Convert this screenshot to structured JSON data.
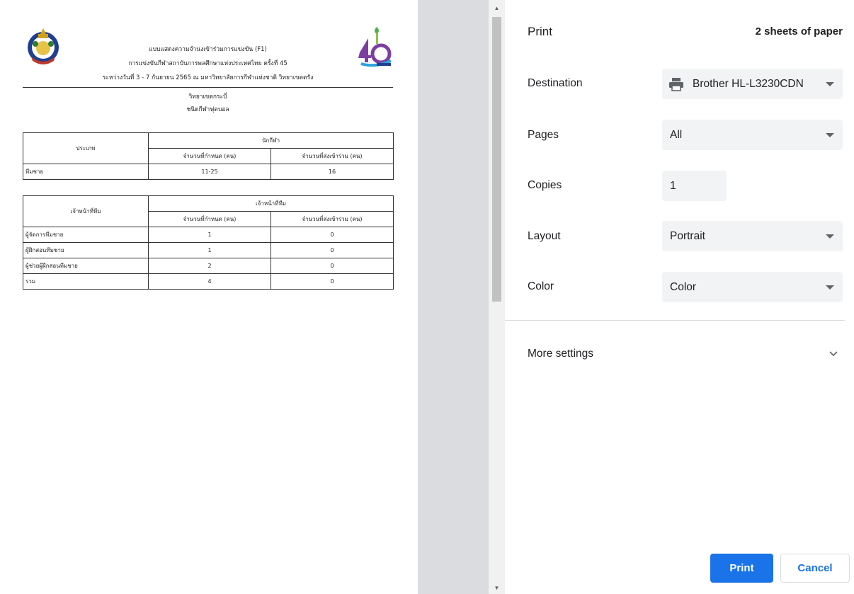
{
  "preview": {
    "header": {
      "line1": "แบบแสดงความจำนงเข้าร่วมการแข่งขัน (F1)",
      "line2": "การแข่งขันกีฬาสถาบันการพลศึกษาแห่งประเทศไทย ครั้งที่ 45",
      "line3": "ระหว่างวันที่ 3 - 7 กันยายน 2565 ณ มหาวิทยาลัยการกีฬาแห่งชาติ วิทยาเขตตรัง"
    },
    "campus": "วิทยาเขตกระบี่",
    "sport": "ชนิดกีฬาฟุตบอล",
    "table1": {
      "col_type": "ประเภท",
      "group": "นักกีฬา",
      "col_required": "จำนวนที่กำหนด (คน)",
      "col_submitted": "จำนวนที่ส่งเข้าร่วม (คน)",
      "rows": [
        {
          "name": "ทีมชาย",
          "required": "11-25",
          "submitted": "16"
        }
      ]
    },
    "table2": {
      "col_type": "เจ้าหน้าที่ทีม",
      "group": "เจ้าหน้าที่ทีม",
      "col_required": "จำนวนที่กำหนด (คน)",
      "col_submitted": "จำนวนที่ส่งเข้าร่วม (คน)",
      "rows": [
        {
          "name": "ผู้จัดการทีมชาย",
          "required": "1",
          "submitted": "0"
        },
        {
          "name": "ผู้ฝึกสอนทีมชาย",
          "required": "1",
          "submitted": "0"
        },
        {
          "name": "ผู้ช่วยผู้ฝึกสอนทีมชาย",
          "required": "2",
          "submitted": "0"
        },
        {
          "name": "รวม",
          "required": "4",
          "submitted": "0"
        }
      ]
    }
  },
  "panel": {
    "title": "Print",
    "sheets": "2 sheets of paper",
    "destination": {
      "label": "Destination",
      "value": "Brother HL-L3230CDN",
      "icon": "printer-icon"
    },
    "pages": {
      "label": "Pages",
      "value": "All"
    },
    "copies": {
      "label": "Copies",
      "value": "1"
    },
    "layout": {
      "label": "Layout",
      "value": "Portrait"
    },
    "color": {
      "label": "Color",
      "value": "Color"
    },
    "more_settings": "More settings",
    "print_button": "Print",
    "cancel_button": "Cancel"
  },
  "colors": {
    "accent": "#1a73e8",
    "control_bg": "#f1f3f4",
    "gutter": "#dadce0"
  }
}
